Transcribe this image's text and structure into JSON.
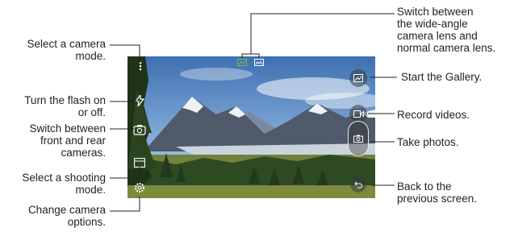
{
  "callouts_left": [
    {
      "id": "camera-mode",
      "lines": [
        "Select a camera",
        "mode."
      ]
    },
    {
      "id": "flash",
      "lines": [
        "Turn the flash on",
        "or off."
      ]
    },
    {
      "id": "switch-camera",
      "lines": [
        "Switch between",
        "front and rear",
        "cameras."
      ]
    },
    {
      "id": "shooting-mode",
      "lines": [
        "Select a shooting",
        "mode."
      ]
    },
    {
      "id": "camera-options",
      "lines": [
        "Change camera",
        "options."
      ]
    }
  ],
  "callouts_right": [
    {
      "id": "lens",
      "lines": [
        "Switch between",
        "the wide-angle",
        "camera lens and",
        "normal camera lens."
      ]
    },
    {
      "id": "gallery",
      "lines": [
        "Start the Gallery."
      ]
    },
    {
      "id": "record",
      "lines": [
        "Record videos."
      ]
    },
    {
      "id": "photo",
      "lines": [
        "Take photos."
      ]
    },
    {
      "id": "back",
      "lines": [
        "Back to the",
        "previous screen."
      ]
    }
  ],
  "colors": {
    "leader_line": "#231f20",
    "sky_top": "#3e6fb0",
    "sky_bottom": "#a9c6e4",
    "mountain": "#4f5a6b",
    "snow": "#eef2f6",
    "lake": "#c9d3da",
    "forest": "#2e4a22",
    "grass": "#7d8b3e",
    "lens_active": "#7ac143"
  },
  "icons": [
    "menu-dots-icon",
    "flash-icon",
    "switch-camera-icon",
    "shooting-mode-icon",
    "settings-gear-icon",
    "wide-lens-icon",
    "normal-lens-icon",
    "gallery-icon",
    "video-icon",
    "shutter-icon",
    "back-icon"
  ]
}
